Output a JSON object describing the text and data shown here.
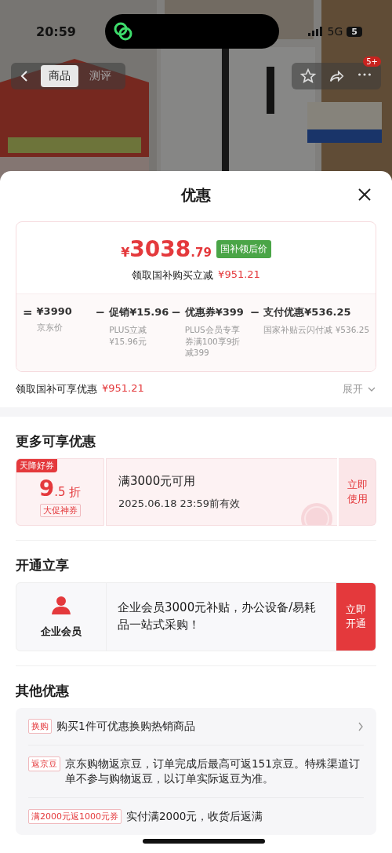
{
  "status_bar": {
    "time": "20:59",
    "network": "5G",
    "battery": "5"
  },
  "nav": {
    "tabs": [
      {
        "label": "商品",
        "selected": true
      },
      {
        "label": "测评",
        "selected": false
      }
    ],
    "badge": "5+"
  },
  "sheet": {
    "title": "优惠"
  },
  "price_card": {
    "currency": "¥",
    "integer": "3038",
    "decimals": ".79",
    "tag": "国补领后价",
    "subtitle": "领取国补购买立减",
    "subtitle_amount": "¥951.21",
    "breakdown": [
      {
        "operator": "=",
        "amount": "¥3990",
        "note": "京东价"
      },
      {
        "operator": "−",
        "label": "促销",
        "amount": "¥15.96",
        "note": "PLUS立减 ¥15.96元"
      },
      {
        "operator": "−",
        "label": "优惠券",
        "amount": "¥399",
        "note": "PLUS会员专享券满100享9折减399"
      },
      {
        "operator": "−",
        "label": "支付优惠",
        "amount": "¥536.25",
        "note": "国家补贴云闪付减 ¥536.25"
      }
    ]
  },
  "summary": {
    "label": "领取国补可享优惠",
    "amount": "¥951.21",
    "toggle": "展开",
    "expanded": false
  },
  "more_offers": {
    "title": "更多可享优惠",
    "coupon": {
      "ribbon": "天降好券",
      "big": "9",
      "small": ".5",
      "unit": "折",
      "tag": "大促神券",
      "condition": "满3000元可用",
      "validity": "2025.06.18 23:59前有效",
      "action": "立即使用"
    }
  },
  "membership": {
    "title": "开通立享",
    "name": "企业会员",
    "description": "企业会员3000元补贴，办公设备/易耗品一站式采购！",
    "action": "立即开通"
  },
  "other_offers": {
    "title": "其他优惠",
    "items": [
      {
        "tag": "换购",
        "text": "购买1件可优惠换购热销商品",
        "chevron": true
      },
      {
        "tag": "返京豆",
        "text": "京东购物返京豆，订单完成后最高可返151京豆。特殊渠道订单不参与购物返豆，以订单实际返豆为准。",
        "chevron": false
      },
      {
        "tag": "满2000元返1000元券",
        "text": "实付满2000元，收货后返满",
        "chevron": false
      }
    ]
  }
}
